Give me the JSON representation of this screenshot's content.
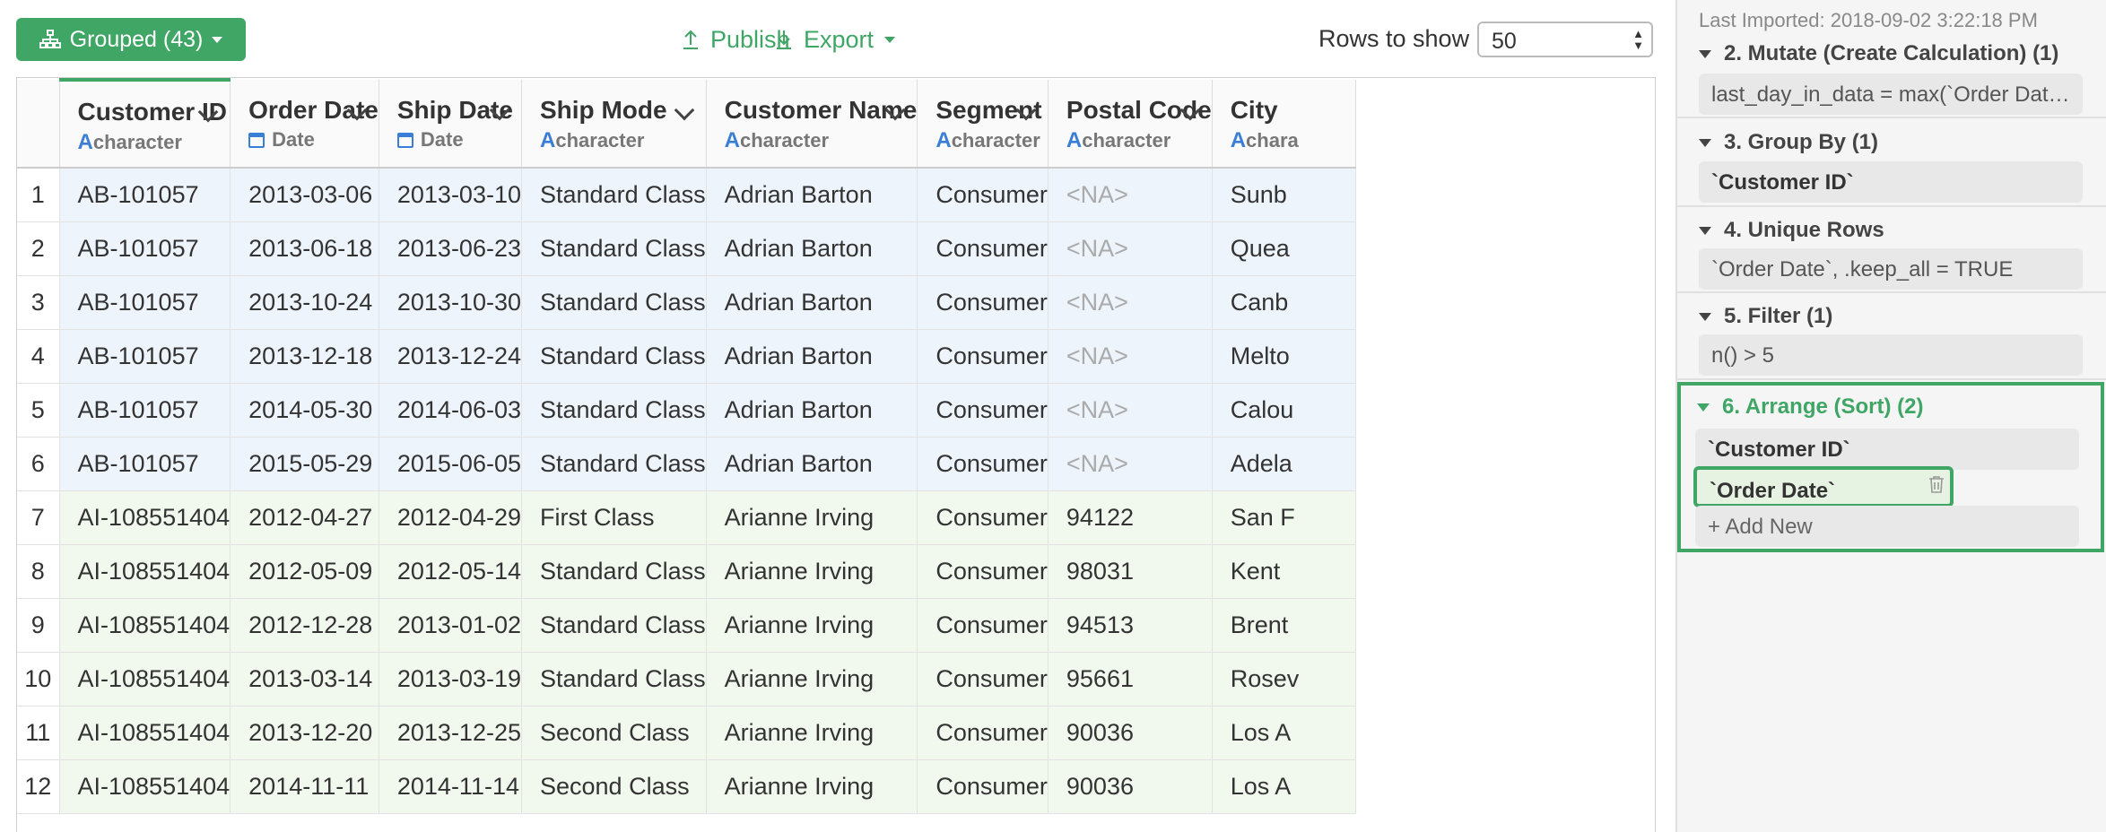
{
  "toolbar": {
    "grouped_label": "Grouped (43)",
    "publish_label": "Publish",
    "export_label": "Export",
    "rows_label": "Rows to show",
    "rows_value": "50"
  },
  "table": {
    "columns": [
      {
        "name": "Customer ID",
        "type": "character",
        "icon": "text-type-icon"
      },
      {
        "name": "Order Date",
        "type": "Date",
        "icon": "calendar-icon"
      },
      {
        "name": "Ship Date",
        "type": "Date",
        "icon": "calendar-icon"
      },
      {
        "name": "Ship Mode",
        "type": "character",
        "icon": "text-type-icon"
      },
      {
        "name": "Customer Name",
        "type": "character",
        "icon": "text-type-icon"
      },
      {
        "name": "Segment",
        "type": "character",
        "icon": "text-type-icon"
      },
      {
        "name": "Postal Code",
        "type": "character",
        "icon": "text-type-icon"
      },
      {
        "name": "City",
        "type": "chara",
        "icon": "text-type-icon"
      }
    ],
    "type_letter": "A",
    "rows": [
      {
        "n": "1",
        "cells": [
          "AB-101057",
          "2013-03-06",
          "2013-03-10",
          "Standard Class",
          "Adrian Barton",
          "Consumer",
          "<NA>",
          "Sunb"
        ]
      },
      {
        "n": "2",
        "cells": [
          "AB-101057",
          "2013-06-18",
          "2013-06-23",
          "Standard Class",
          "Adrian Barton",
          "Consumer",
          "<NA>",
          "Quea"
        ]
      },
      {
        "n": "3",
        "cells": [
          "AB-101057",
          "2013-10-24",
          "2013-10-30",
          "Standard Class",
          "Adrian Barton",
          "Consumer",
          "<NA>",
          "Canb"
        ]
      },
      {
        "n": "4",
        "cells": [
          "AB-101057",
          "2013-12-18",
          "2013-12-24",
          "Standard Class",
          "Adrian Barton",
          "Consumer",
          "<NA>",
          "Melto"
        ]
      },
      {
        "n": "5",
        "cells": [
          "AB-101057",
          "2014-05-30",
          "2014-06-03",
          "Standard Class",
          "Adrian Barton",
          "Consumer",
          "<NA>",
          "Calou"
        ]
      },
      {
        "n": "6",
        "cells": [
          "AB-101057",
          "2015-05-29",
          "2015-06-05",
          "Standard Class",
          "Adrian Barton",
          "Consumer",
          "<NA>",
          "Adela"
        ]
      },
      {
        "n": "7",
        "cells": [
          "AI-108551404",
          "2012-04-27",
          "2012-04-29",
          "First Class",
          "Arianne Irving",
          "Consumer",
          "94122",
          "San F"
        ]
      },
      {
        "n": "8",
        "cells": [
          "AI-108551404",
          "2012-05-09",
          "2012-05-14",
          "Standard Class",
          "Arianne Irving",
          "Consumer",
          "98031",
          "Kent"
        ]
      },
      {
        "n": "9",
        "cells": [
          "AI-108551404",
          "2012-12-28",
          "2013-01-02",
          "Standard Class",
          "Arianne Irving",
          "Consumer",
          "94513",
          "Brent"
        ]
      },
      {
        "n": "10",
        "cells": [
          "AI-108551404",
          "2013-03-14",
          "2013-03-19",
          "Standard Class",
          "Arianne Irving",
          "Consumer",
          "95661",
          "Rosev"
        ]
      },
      {
        "n": "11",
        "cells": [
          "AI-108551404",
          "2013-12-20",
          "2013-12-25",
          "Second Class",
          "Arianne Irving",
          "Consumer",
          "90036",
          "Los A"
        ]
      },
      {
        "n": "12",
        "cells": [
          "AI-108551404",
          "2014-11-11",
          "2014-11-14",
          "Second Class",
          "Arianne Irving",
          "Consumer",
          "90036",
          "Los A"
        ]
      }
    ]
  },
  "sidebar": {
    "last_imported": "Last Imported: 2018-09-02 3:22:18 PM",
    "steps": [
      {
        "title": "2. Mutate (Create Calculation) (1)",
        "chips": [
          "last_day_in_data = max(`Order Dat…"
        ]
      },
      {
        "title": "3. Group By (1)",
        "chips": [
          "`Customer ID`"
        ]
      },
      {
        "title": "4. Unique Rows",
        "chips": [
          "`Order Date`, .keep_all = TRUE"
        ]
      },
      {
        "title": "5. Filter (1)",
        "chips": [
          "n() > 5"
        ]
      },
      {
        "title": "6. Arrange (Sort) (2)",
        "chips": [
          "`Customer ID`",
          "`Order Date`"
        ]
      }
    ],
    "add_new_label": "+ Add New"
  },
  "colors": {
    "accent": "#3fa665",
    "type_icon": "#3a7fd5",
    "group1_bg": "#eef4fc",
    "group2_bg": "#f1f8ee"
  }
}
